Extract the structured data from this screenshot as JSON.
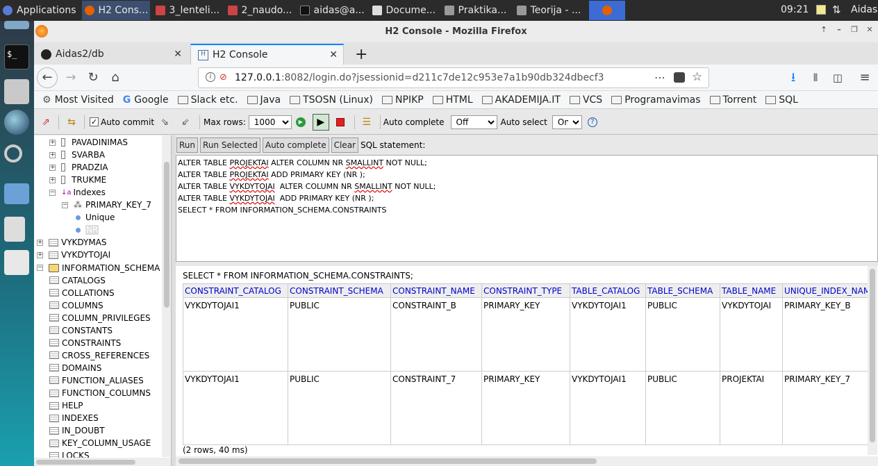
{
  "panel": {
    "apps": "Applications",
    "tasks": [
      "H2 Cons...",
      "3_lenteli...",
      "2_naudo...",
      "aidas@a...",
      "Docume...",
      "Praktika...",
      "Teorija - ..."
    ],
    "clock": "09:21",
    "user": "Aidas"
  },
  "window": {
    "title": "H2 Console - Mozilla Firefox"
  },
  "tabs": [
    {
      "label": "Aidas2/db"
    },
    {
      "label": "H2 Console"
    }
  ],
  "url": {
    "host": "127.0.0.1",
    "rest": ":8082/login.do?jsessionid=d211c7de12c953e7a1b90db324dbecf3"
  },
  "bookmarks": [
    "Most Visited",
    "Google",
    "Slack etc.",
    "Java",
    "TSOSN (Linux)",
    "NPIKP",
    "HTML",
    "AKADEMIJA.IT",
    "VCS",
    "Programavimas",
    "Torrent",
    "SQL"
  ],
  "h2toolbar": {
    "auto_commit": "Auto commit",
    "max_rows_label": "Max rows:",
    "max_rows": "1000",
    "auto_complete_label": "Auto complete",
    "auto_complete": "Off",
    "auto_select_label": "Auto select",
    "auto_select": "On"
  },
  "tree": {
    "cols": [
      "PAVADINIMAS",
      "SVARBA",
      "PRADZIA",
      "TRUKME"
    ],
    "indexes": "Indexes",
    "pk": "PRIMARY_KEY_7",
    "unique": "Unique",
    "nr": "NR",
    "tables": [
      "VYKDYMAS",
      "VYKDYTOJAI"
    ],
    "schema": "INFORMATION_SCHEMA",
    "schema_tables": [
      "CATALOGS",
      "COLLATIONS",
      "COLUMNS",
      "COLUMN_PRIVILEGES",
      "CONSTANTS",
      "CONSTRAINTS",
      "CROSS_REFERENCES",
      "DOMAINS",
      "FUNCTION_ALIASES",
      "FUNCTION_COLUMNS",
      "HELP",
      "INDEXES",
      "IN_DOUBT",
      "KEY_COLUMN_USAGE",
      "LOCKS"
    ]
  },
  "query": {
    "run": "Run",
    "run_selected": "Run Selected",
    "auto_complete": "Auto complete",
    "clear": "Clear",
    "label": "SQL statement:"
  },
  "sql": [
    [
      "ALTER TABLE ",
      "PROJEKTAI",
      " ALTER COLUMN NR ",
      "SMALLINT",
      " NOT NULL;"
    ],
    [
      "ALTER TABLE ",
      "PROJEKTAI",
      " ADD PRIMARY KEY (NR );",
      "",
      ""
    ],
    [
      "ALTER TABLE ",
      "VYKDYTOJAI",
      "  ALTER COLUMN NR ",
      "SMALLINT",
      " NOT NULL;"
    ],
    [
      "ALTER TABLE ",
      "VYKDYTOJAI",
      "  ADD PRIMARY KEY (NR );",
      "",
      ""
    ],
    [
      "SELECT * FROM INFORMATION_SCHEMA.CONSTRAINTS",
      "",
      "",
      "",
      ""
    ]
  ],
  "result": {
    "title": "SELECT * FROM INFORMATION_SCHEMA.CONSTRAINTS;",
    "headers": [
      "CONSTRAINT_CATALOG",
      "CONSTRAINT_SCHEMA",
      "CONSTRAINT_NAME",
      "CONSTRAINT_TYPE",
      "TABLE_CATALOG",
      "TABLE_SCHEMA",
      "TABLE_NAME",
      "UNIQUE_INDEX_NAM"
    ],
    "rows": [
      [
        "VYKDYTOJAI1",
        "PUBLIC",
        "CONSTRAINT_B",
        "PRIMARY_KEY",
        "VYKDYTOJAI1",
        "PUBLIC",
        "VYKDYTOJAI",
        "PRIMARY_KEY_B"
      ],
      [
        "VYKDYTOJAI1",
        "PUBLIC",
        "CONSTRAINT_7",
        "PRIMARY_KEY",
        "VYKDYTOJAI1",
        "PUBLIC",
        "PROJEKTAI",
        "PRIMARY_KEY_7"
      ]
    ],
    "summary": "(2 rows, 40 ms)"
  }
}
